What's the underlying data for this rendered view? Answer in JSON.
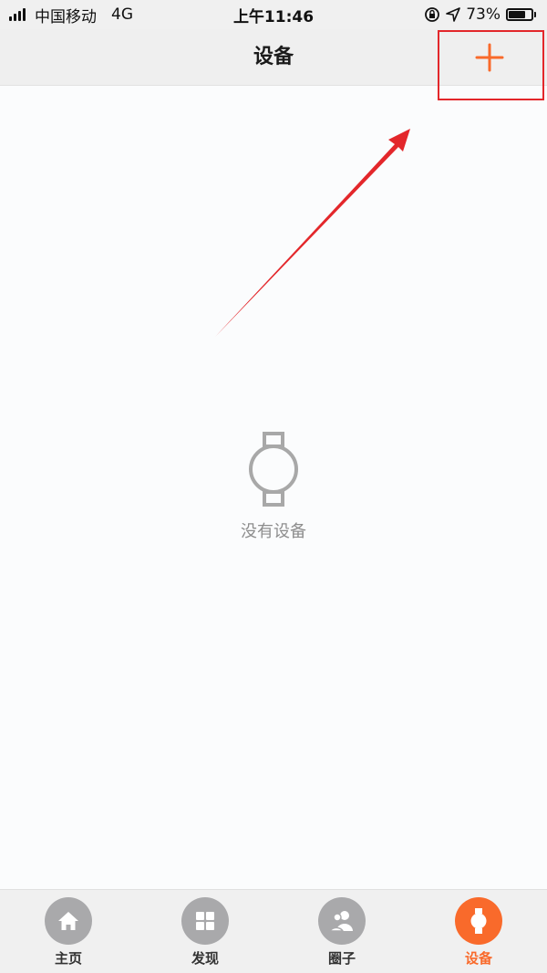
{
  "status_bar": {
    "carrier": "中国移动",
    "network": "4G",
    "time": "上午11:46",
    "battery_percent": "73%",
    "battery_level": 0.73,
    "icons": [
      "signal-icon",
      "rotation-lock-icon",
      "location-arrow-icon",
      "battery-icon"
    ]
  },
  "nav": {
    "title": "设备",
    "add_icon": "plus-icon"
  },
  "empty_state": {
    "icon": "watch-icon",
    "text": "没有设备"
  },
  "tabs": [
    {
      "label": "主页",
      "icon": "home-icon",
      "active": false
    },
    {
      "label": "发现",
      "icon": "grid-icon",
      "active": false
    },
    {
      "label": "圈子",
      "icon": "people-icon",
      "active": false
    },
    {
      "label": "设备",
      "icon": "watch-icon",
      "active": true
    }
  ],
  "colors": {
    "accent": "#f96a2b",
    "annotation_red": "#e3272b",
    "inactive_icon": "#a9a9ab",
    "muted_text": "#8d8d8d"
  }
}
